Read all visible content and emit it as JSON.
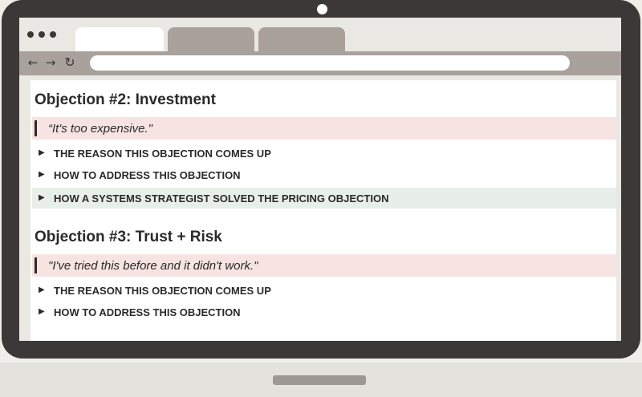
{
  "browser": {
    "tabs": [
      "",
      "",
      ""
    ],
    "url": ""
  },
  "objections": [
    {
      "title": "Objection #2: Investment",
      "quote": "“It's too expensive.\"",
      "toggles": [
        "THE REASON THIS OBJECTION COMES UP",
        "HOW TO ADDRESS THIS OBJECTION",
        "HOW A SYSTEMS STRATEGIST SOLVED THE PRICING OBJECTION"
      ]
    },
    {
      "title": "Objection #3: Trust + Risk",
      "quote": "\"I've tried this before and it didn't work.\"",
      "toggles": [
        "THE REASON THIS OBJECTION COMES UP",
        "HOW TO ADDRESS THIS OBJECTION"
      ]
    }
  ],
  "icons": {
    "back": "arrow-left-icon",
    "forward": "arrow-right-icon",
    "reload": "reload-icon",
    "toggle": "triangle-right-icon"
  },
  "colors": {
    "frame": "#3b3837",
    "quote_bg": "#f6e3e2",
    "highlight_bg": "#e8efe9",
    "chrome_gray": "#a8a19c"
  }
}
